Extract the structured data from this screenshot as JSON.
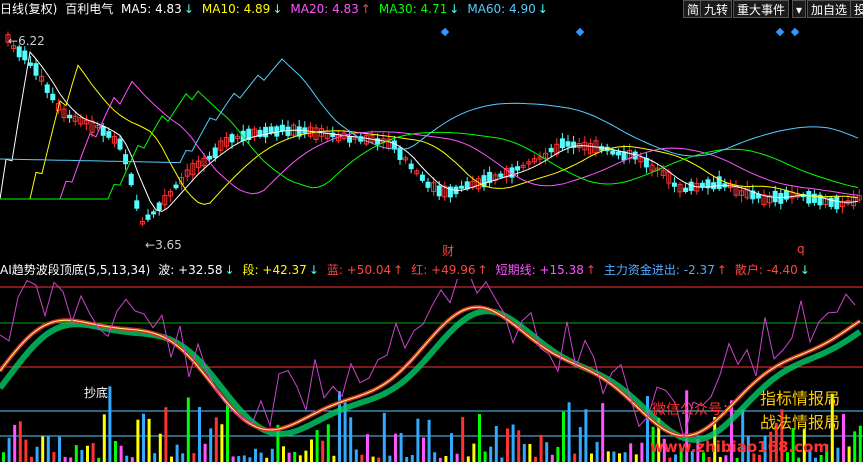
{
  "main_header": {
    "period": "日线(复权)",
    "stock": "百利电气",
    "ma": [
      {
        "label": "MA5:",
        "value": "4.83",
        "arrow": "↓",
        "color": "#ffffff"
      },
      {
        "label": "MA10:",
        "value": "4.89",
        "arrow": "↓",
        "color": "#ffff00"
      },
      {
        "label": "MA20:",
        "value": "4.83",
        "arrow": "↑",
        "color": "#ff55ff"
      },
      {
        "label": "MA30:",
        "value": "4.71",
        "arrow": "↓",
        "color": "#00ff00"
      },
      {
        "label": "MA60:",
        "value": "4.90",
        "arrow": "↓",
        "color": "#55ccff"
      }
    ]
  },
  "toolbar": {
    "simple": "简",
    "nine": "九转",
    "events": "重大事件",
    "dropdown": "▾",
    "add_fav": "加自选",
    "extra": "投"
  },
  "price_labels": {
    "high": "6.22",
    "low": "3.65",
    "marker_cai": "财",
    "marker_q": "q"
  },
  "ind_header": {
    "name": "AI趋势波段顶底(5,5,13,34)",
    "items": [
      {
        "label": "波:",
        "value": "+32.58",
        "arrow": "↓",
        "color": "#ffffff"
      },
      {
        "label": "段:",
        "value": "+42.37",
        "arrow": "↓",
        "color": "#ffff00"
      },
      {
        "label": "蓝:",
        "value": "+50.04",
        "arrow": "↑",
        "color": "#ff4444"
      },
      {
        "label": "红:",
        "value": "+49.96",
        "arrow": "↑",
        "color": "#ff4444"
      },
      {
        "label": "短期线:",
        "value": "+15.38",
        "arrow": "↑",
        "color": "#ff55ff"
      },
      {
        "label": "主力资金进出:",
        "value": "-2.37",
        "arrow": "↑",
        "color": "#55aaff"
      },
      {
        "label": "散户:",
        "value": "-4.40",
        "arrow": "↓",
        "color": "#ff4444"
      }
    ]
  },
  "ind_labels": {
    "chaodi": "抄底"
  },
  "watermark": {
    "wechat": "微信公众号：",
    "brand1": "指标情报局",
    "brand2": "战法情报局",
    "site": "www.zhibiao168.com"
  },
  "colors": {
    "up": "#ff3232",
    "down": "#54fcfc",
    "bg": "#000000"
  }
}
